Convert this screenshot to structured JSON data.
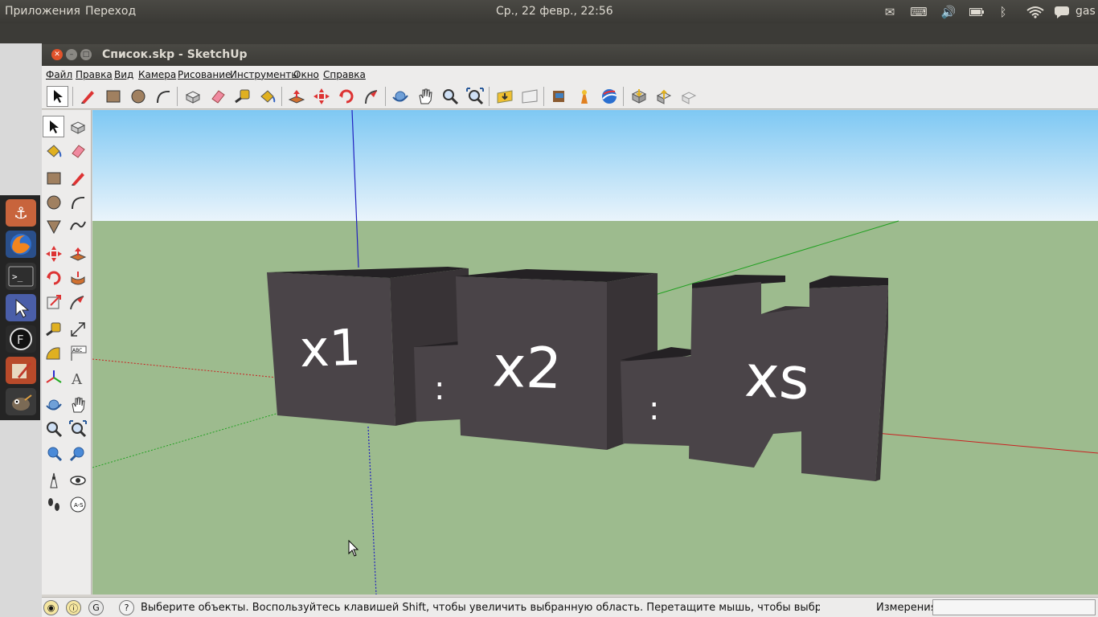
{
  "topbar": {
    "menu_apps": "Приложения",
    "menu_go": "Переход",
    "clock": "Ср., 22 февр., 22:56",
    "user": "gas",
    "tray_icons": [
      "mail-icon",
      "keyboard-icon",
      "volume-icon",
      "battery-icon",
      "bluetooth-icon",
      "wifi-icon",
      "chat-icon"
    ]
  },
  "launcher": {
    "icons": [
      "anchor-icon",
      "firefox-icon",
      "terminal-icon",
      "sketchup-icon",
      "fontforge-icon",
      "draw-icon",
      "gimp-icon"
    ]
  },
  "window": {
    "title": "Список.skp - SketchUp"
  },
  "menubar": {
    "items": [
      "Файл",
      "Правка",
      "Вид",
      "Камера",
      "Рисование",
      "Инструменты",
      "Окно",
      "Справка"
    ]
  },
  "toolbar": {
    "tools": [
      "select",
      "pencil",
      "rectangle",
      "circle",
      "arc",
      "make-component",
      "eraser",
      "tape-measure",
      "paint-bucket",
      "push-pull",
      "move",
      "rotate",
      "follow-me",
      "orbit",
      "pan",
      "zoom",
      "zoom-extents",
      "get-models",
      "share-model",
      "place-model",
      "get-photo-texture",
      "google-earth",
      "send-to-layout",
      "get-components",
      "share-component"
    ]
  },
  "scene": {
    "labels": [
      "x1",
      "x2",
      "xs"
    ],
    "separators": [
      ":",
      ":"
    ],
    "colors": {
      "sky_top": "#7ec8f3",
      "sky_bottom": "#eaf4fb",
      "ground": "#9dbb8e",
      "box_front": "#4a4448",
      "box_side": "#383336",
      "box_top": "#242124",
      "axis_red": "#c92020",
      "axis_green": "#20a020",
      "axis_blue": "#2020c0"
    }
  },
  "status": {
    "hint": "Выберите объекты. Воспользуйтесь клавишей Shift, чтобы увеличить выбранную область. Перетащите мышь, чтобы выбрать несколько объ",
    "measure_label": "Измерения",
    "measure_value": ""
  }
}
